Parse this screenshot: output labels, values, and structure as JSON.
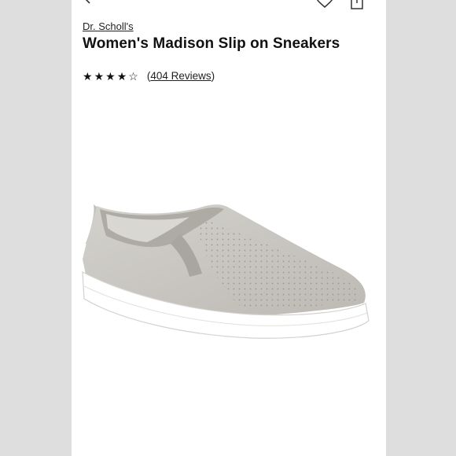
{
  "product": {
    "brand": "Dr. Scholl's",
    "title": "Women's Madison Slip on Sneakers",
    "rating": 4,
    "rating_max": 5,
    "reviews_open": "(",
    "reviews_text": "404 Reviews",
    "reviews_close": ")"
  },
  "icons": {
    "back": "chevron-left-icon",
    "wishlist": "heart-icon",
    "share": "share-icon",
    "star_full": "★",
    "star_empty": "☆"
  },
  "colors": {
    "page_background": "#dedede",
    "card_background": "#ffffff",
    "shoe_upper": "#c9c7c2",
    "sole": "#ffffff"
  }
}
